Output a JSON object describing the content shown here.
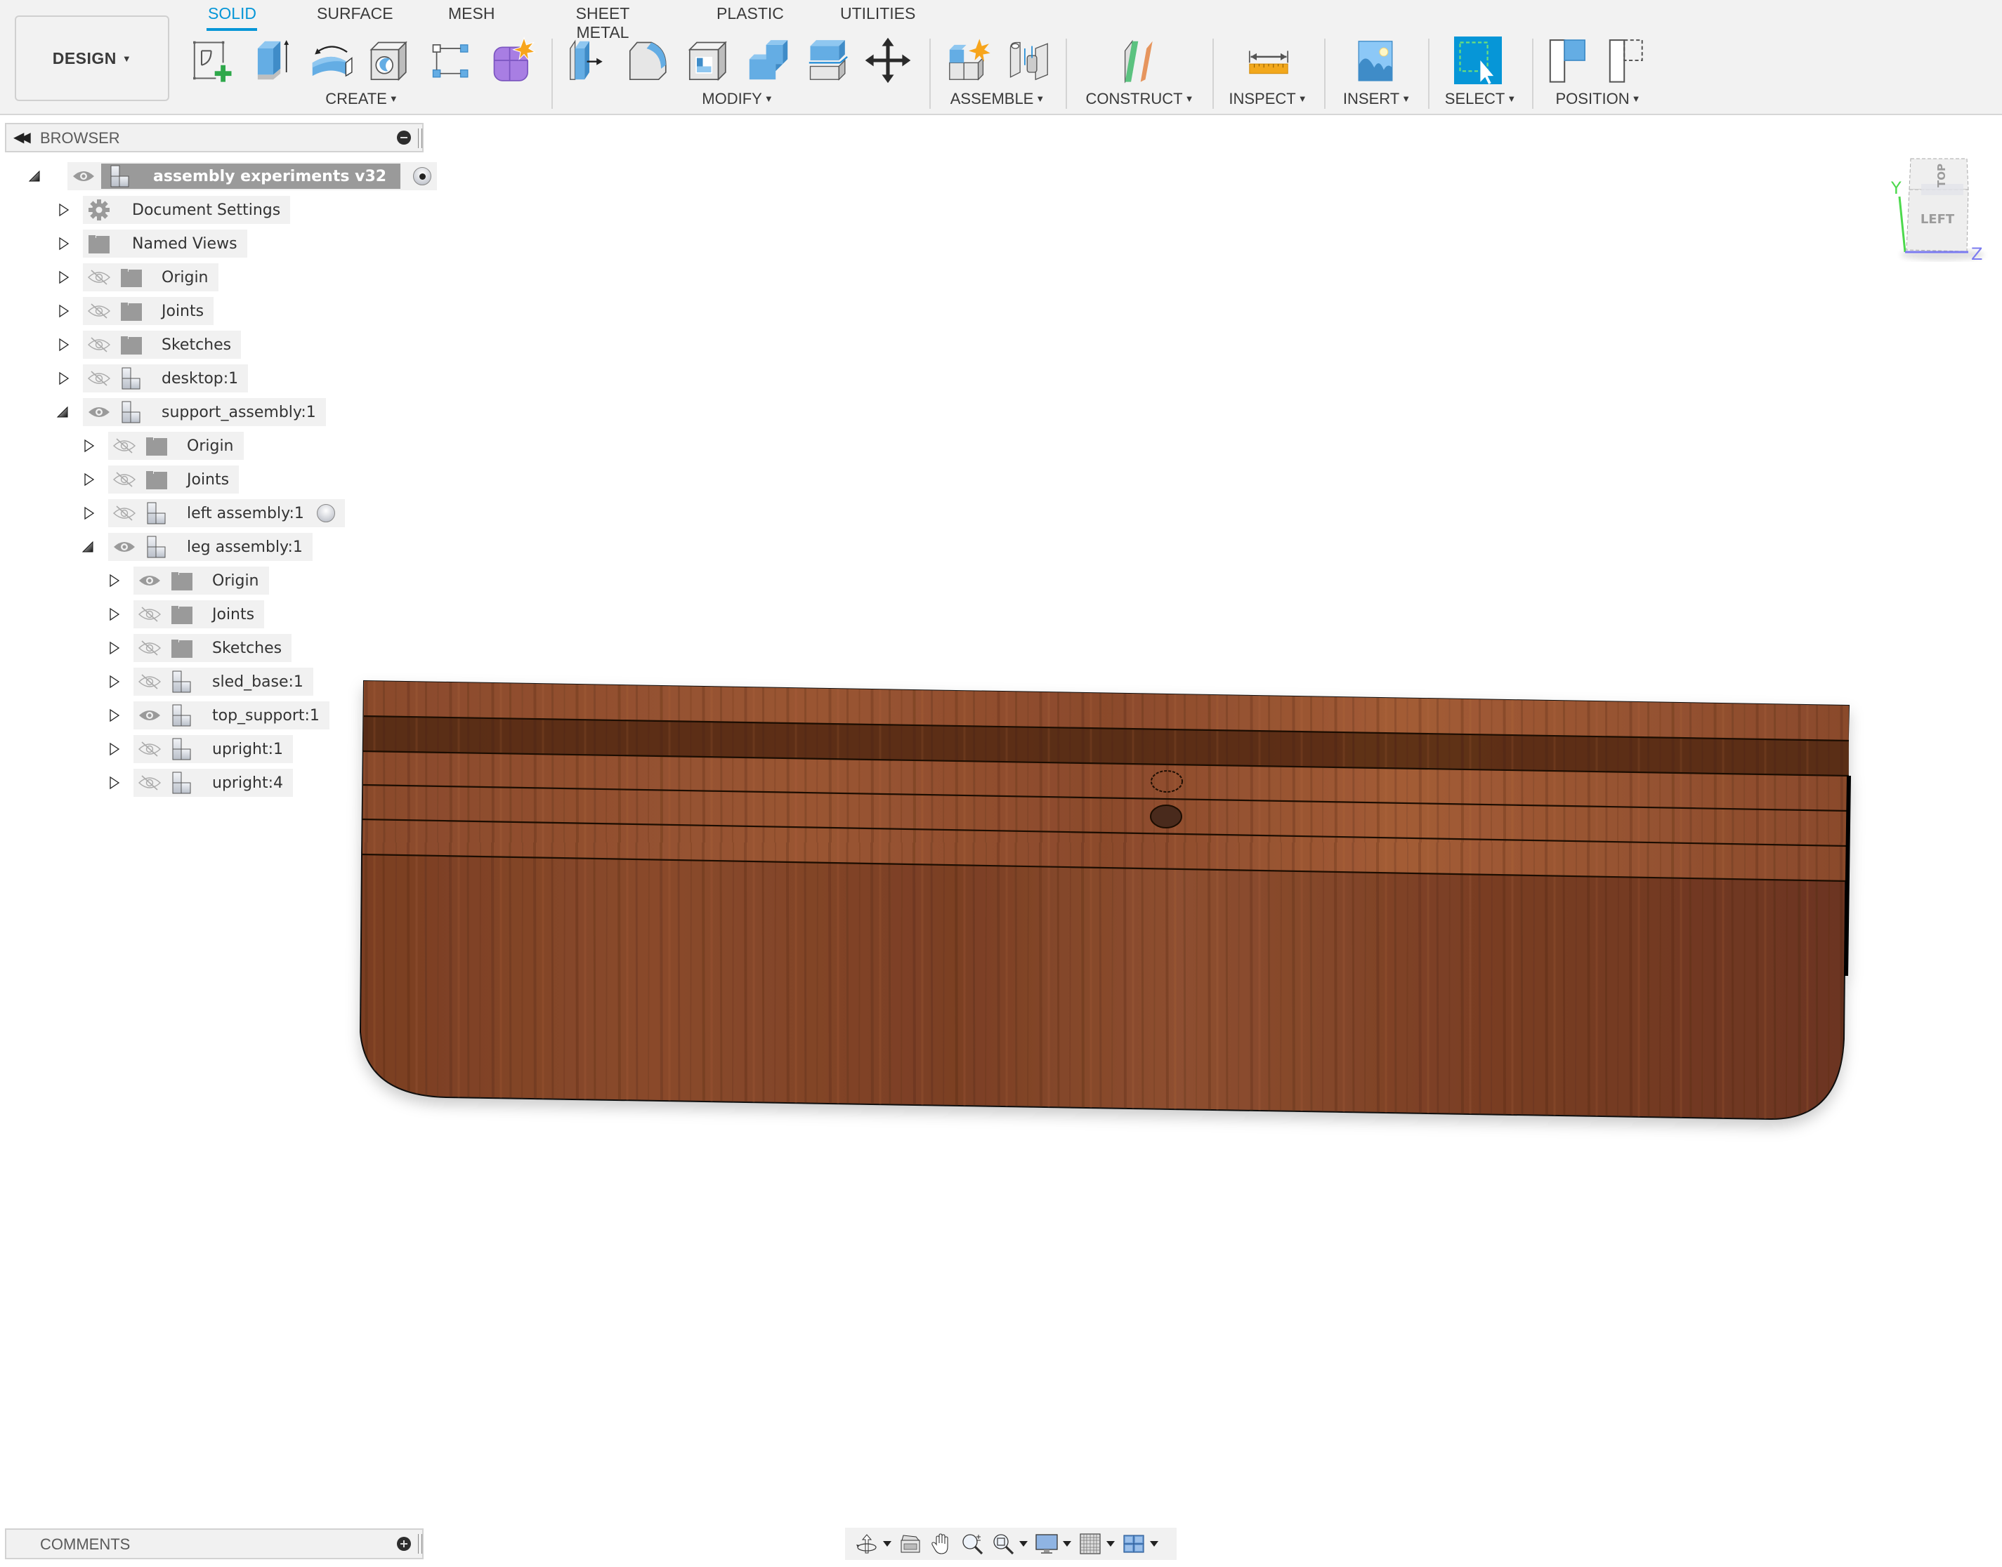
{
  "toolbar": {
    "workspace_label": "DESIGN",
    "tabs": [
      {
        "label": "SOLID",
        "active": true
      },
      {
        "label": "SURFACE",
        "active": false
      },
      {
        "label": "MESH",
        "active": false
      },
      {
        "label": "SHEET METAL",
        "active": false
      },
      {
        "label": "PLASTIC",
        "active": false
      },
      {
        "label": "UTILITIES",
        "active": false
      }
    ],
    "groups": {
      "create": "CREATE",
      "modify": "MODIFY",
      "assemble": "ASSEMBLE",
      "construct": "CONSTRUCT",
      "inspect": "INSPECT",
      "insert": "INSERT",
      "select": "SELECT",
      "position": "POSITION"
    },
    "tools": {
      "create": [
        "create-sketch-icon",
        "extrude-icon",
        "revolve-icon",
        "hole-icon",
        "pattern-icon",
        "create-form-icon"
      ],
      "modify": [
        "press-pull-icon",
        "fillet-icon",
        "shell-icon",
        "combine-icon",
        "split-body-icon",
        "move-copy-icon"
      ],
      "assemble": [
        "new-component-icon",
        "joint-icon"
      ],
      "construct": [
        "offset-plane-icon"
      ],
      "inspect": [
        "measure-icon"
      ],
      "insert": [
        "insert-image-icon"
      ],
      "select": [
        "window-select-icon"
      ],
      "position": [
        "capture-position-icon",
        "revert-position-icon"
      ]
    },
    "accent_color": "#0696d7"
  },
  "browser": {
    "title": "BROWSER",
    "tree": [
      {
        "label": "assembly experiments v32",
        "level": 0,
        "expanded": true,
        "visible": true,
        "icon": "component",
        "active_radio": true,
        "root": true
      },
      {
        "label": "Document Settings",
        "level": 1,
        "expanded": false,
        "visible": null,
        "icon": "gear"
      },
      {
        "label": "Named Views",
        "level": 1,
        "expanded": false,
        "visible": null,
        "icon": "folder"
      },
      {
        "label": "Origin",
        "level": 1,
        "expanded": false,
        "visible": false,
        "icon": "folder"
      },
      {
        "label": "Joints",
        "level": 1,
        "expanded": false,
        "visible": false,
        "icon": "folder"
      },
      {
        "label": "Sketches",
        "level": 1,
        "expanded": false,
        "visible": false,
        "icon": "folder"
      },
      {
        "label": "desktop:1",
        "level": 1,
        "expanded": false,
        "visible": false,
        "icon": "component"
      },
      {
        "label": "support_assembly:1",
        "level": 1,
        "expanded": true,
        "visible": true,
        "icon": "component"
      },
      {
        "label": "Origin",
        "level": 2,
        "expanded": false,
        "visible": false,
        "icon": "folder"
      },
      {
        "label": "Joints",
        "level": 2,
        "expanded": false,
        "visible": false,
        "icon": "folder"
      },
      {
        "label": "left assembly:1",
        "level": 2,
        "expanded": false,
        "visible": false,
        "icon": "component",
        "radio": true
      },
      {
        "label": "leg assembly:1",
        "level": 2,
        "expanded": true,
        "visible": true,
        "icon": "component"
      },
      {
        "label": "Origin",
        "level": 3,
        "expanded": false,
        "visible": true,
        "icon": "folder"
      },
      {
        "label": "Joints",
        "level": 3,
        "expanded": false,
        "visible": false,
        "icon": "folder"
      },
      {
        "label": "Sketches",
        "level": 3,
        "expanded": false,
        "visible": false,
        "icon": "folder"
      },
      {
        "label": "sled_base:1",
        "level": 3,
        "expanded": false,
        "visible": false,
        "icon": "component"
      },
      {
        "label": "top_support:1",
        "level": 3,
        "expanded": false,
        "visible": true,
        "icon": "component"
      },
      {
        "label": "upright:1",
        "level": 3,
        "expanded": false,
        "visible": false,
        "icon": "component"
      },
      {
        "label": "upright:4",
        "level": 3,
        "expanded": false,
        "visible": false,
        "icon": "component"
      }
    ]
  },
  "comments": {
    "title": "COMMENTS"
  },
  "viewcube": {
    "front_face": "LEFT",
    "top_face": "TOP",
    "axis_y": "Y",
    "axis_z": "Z",
    "axis_y_color": "#4cd94c",
    "axis_z_color": "#7b7bf0"
  },
  "navbar": {
    "items": [
      "orbit-icon",
      "look-at-icon",
      "pan-icon",
      "zoom-icon",
      "fit-icon",
      "display-settings-icon",
      "grid-snap-icon",
      "viewports-icon"
    ]
  },
  "viewport": {
    "model": "wood-panel",
    "wood_color": "#7a3f24"
  }
}
